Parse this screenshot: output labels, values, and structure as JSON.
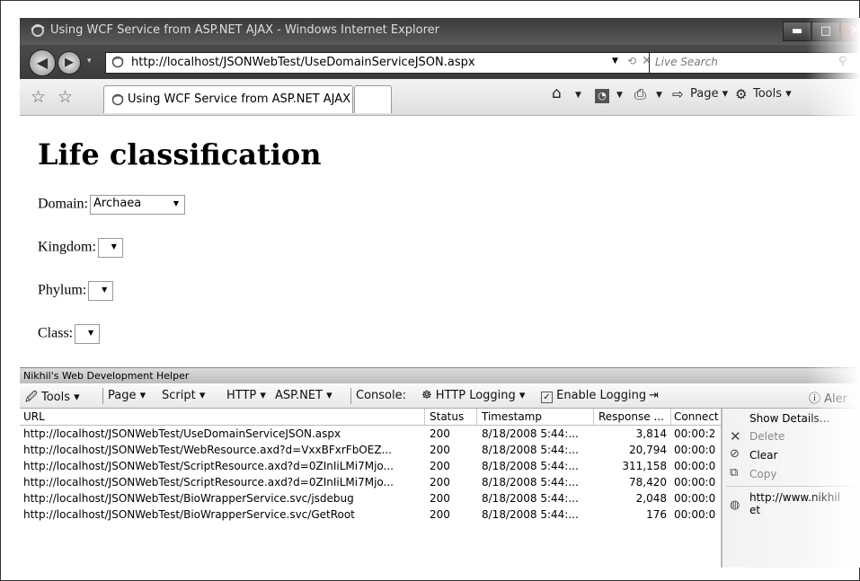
{
  "browser": {
    "window_title": "Using WCF Service from ASP.NET AJAX - Windows Internet Explorer",
    "window_buttons": {
      "minimize": "▬",
      "maximize": "□",
      "close": "✕"
    },
    "url": "http://localhost/JSONWebTest/UseDomainServiceJSON.aspx",
    "search_placeholder": "Live Search",
    "tab_title": "Using WCF Service from ASP.NET AJAX",
    "command_bar": {
      "page_label": "Page",
      "tools_label": "Tools"
    }
  },
  "page": {
    "heading": "Life classification",
    "fields": [
      {
        "label": "Domain:",
        "value": "Archaea"
      },
      {
        "label": "Kingdom:",
        "value": ""
      },
      {
        "label": "Phylum:",
        "value": ""
      },
      {
        "label": "Class:",
        "value": ""
      }
    ]
  },
  "helper": {
    "title": "Nikhil's Web Development Helper",
    "toolbar": {
      "tools": "Tools",
      "page": "Page",
      "script": "Script",
      "http": "HTTP",
      "aspnet": "ASP.NET",
      "console": "Console:",
      "http_logging": "HTTP Logging",
      "enable_logging": "Enable Logging",
      "alerts": "Aler"
    },
    "columns": [
      "URL",
      "Status",
      "Timestamp",
      "Response ...",
      "Connect"
    ],
    "rows": [
      {
        "url": "http://localhost/JSONWebTest/UseDomainServiceJSON.aspx",
        "status": "200",
        "timestamp": "8/18/2008 5:44:...",
        "response": "3,814",
        "connect": "00:00:2"
      },
      {
        "url": "http://localhost/JSONWebTest/WebResource.axd?d=VxxBFxrFbOEZ...",
        "status": "200",
        "timestamp": "8/18/2008 5:44:...",
        "response": "20,794",
        "connect": "00:00:0"
      },
      {
        "url": "http://localhost/JSONWebTest/ScriptResource.axd?d=0ZInIiLMi7Mjo...",
        "status": "200",
        "timestamp": "8/18/2008 5:44:...",
        "response": "311,158",
        "connect": "00:00:0"
      },
      {
        "url": "http://localhost/JSONWebTest/ScriptResource.axd?d=0ZInIiLMi7Mjo...",
        "status": "200",
        "timestamp": "8/18/2008 5:44:...",
        "response": "78,420",
        "connect": "00:00:0"
      },
      {
        "url": "http://localhost/JSONWebTest/BioWrapperService.svc/jsdebug",
        "status": "200",
        "timestamp": "8/18/2008 5:44:...",
        "response": "2,048",
        "connect": "00:00:0"
      },
      {
        "url": "http://localhost/JSONWebTest/BioWrapperService.svc/GetRoot",
        "status": "200",
        "timestamp": "8/18/2008 5:44:...",
        "response": "176",
        "connect": "00:00:0"
      }
    ],
    "context_menu": {
      "show_details": "Show Details...",
      "delete": "Delete",
      "clear": "Clear",
      "copy": "Copy",
      "link_line1": "http://www.nikhil",
      "link_line2": "et"
    }
  }
}
